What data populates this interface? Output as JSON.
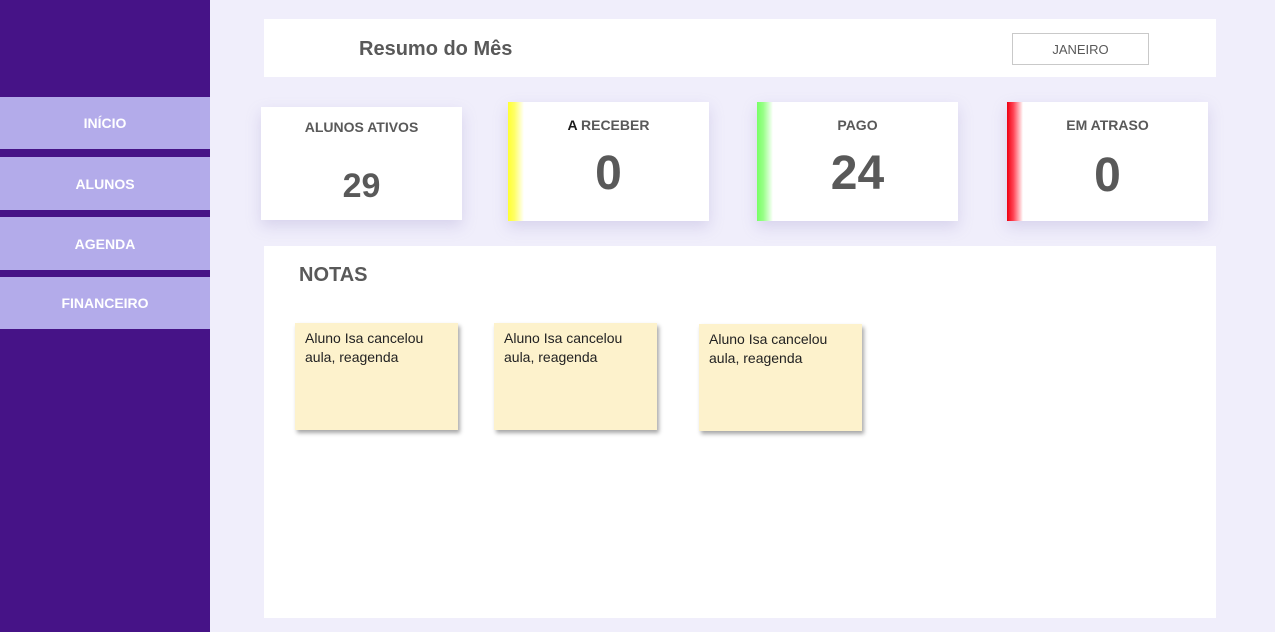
{
  "sidebar": {
    "items": [
      {
        "label": "INÍCIO"
      },
      {
        "label": "ALUNOS"
      },
      {
        "label": "AGENDA"
      },
      {
        "label": "FINANCEIRO"
      }
    ]
  },
  "header": {
    "title": "Resumo do Mês",
    "month_selected": "JANEIRO"
  },
  "stats": {
    "alunos_ativos": {
      "label": "ALUNOS ATIVOS",
      "value": "29"
    },
    "a_receber": {
      "label_a": "A",
      "label_rest": " RECEBER",
      "value": "0",
      "accent": "#ffff33"
    },
    "pago": {
      "label": "PAGO",
      "value": "24",
      "accent": "#77ff66"
    },
    "em_atraso": {
      "label": "EM ATRASO",
      "value": "0",
      "accent": "#ee0011"
    }
  },
  "notes": {
    "title": "NOTAS",
    "items": [
      {
        "text": "Aluno Isa cancelou aula, reagenda"
      },
      {
        "text": "Aluno Isa cancelou aula, reagenda"
      },
      {
        "text": "Aluno Isa cancelou aula, reagenda"
      }
    ]
  },
  "colors": {
    "sidebar_bg": "#461387",
    "nav_item_bg": "#b3abea",
    "page_bg": "#f0eefb",
    "note_bg": "#fdf2cc"
  }
}
